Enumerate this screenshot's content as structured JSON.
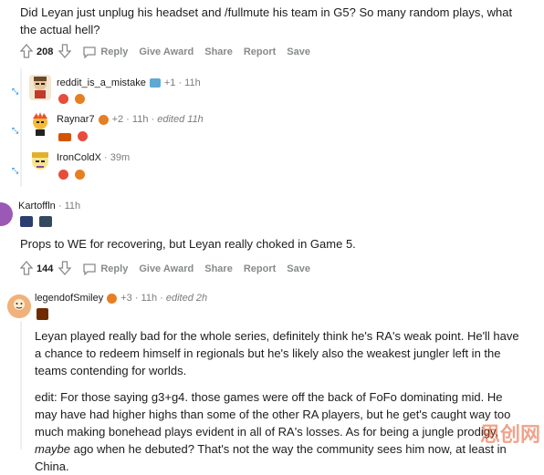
{
  "top_comment": {
    "text": "Did Leyan just unplug his headset and /fullmute his team in G5? So many random plays, what the actual hell?",
    "votes": "208",
    "actions": [
      "Reply",
      "Give Award",
      "Share",
      "Report",
      "Save"
    ]
  },
  "collapsed_replies": [
    {
      "username": "reddit_is_a_mistake",
      "points": "+1",
      "time": "11h",
      "edited": ""
    },
    {
      "username": "Raynar7",
      "points": "+2",
      "time": "11h",
      "edited": "edited 11h"
    },
    {
      "username": "IronColdX",
      "points": "",
      "time": "39m",
      "edited": ""
    }
  ],
  "comment2": {
    "username": "Kartoffln",
    "time": "11h",
    "text": "Props to WE for recovering, but Leyan really choked in Game 5.",
    "votes": "144",
    "actions": [
      "Reply",
      "Give Award",
      "Share",
      "Report",
      "Save"
    ]
  },
  "comment3": {
    "username": "legendofSmiley",
    "points": "+3",
    "time": "11h",
    "edited": "edited 2h",
    "para1": "Leyan played really bad for the whole series, definitely think he's RA's weak point. He'll have a chance to redeem himself in regionals but he's likely also the weakest jungler left in the teams contending for worlds.",
    "para2_start": "edit: For those saying g3+g4. those games were off the back of FoFo dominating mid. He may have had higher highs than some of the other RA players, but he get's caught way too much making bonehead plays evident in all of RA's losses. As for being a jungle prodigy, ",
    "para2_italic": "maybe",
    "para2_end": " ago when he debuted? That's not the way the community sees him now, at least in China."
  },
  "watermark": "思创网",
  "icons": [
    "upvote-icon",
    "downvote-icon",
    "reply-icon",
    "expand-icon"
  ],
  "colors": {
    "accent": "#0079d3",
    "meta": "#7c7c7c",
    "actions": "#878a8c"
  }
}
